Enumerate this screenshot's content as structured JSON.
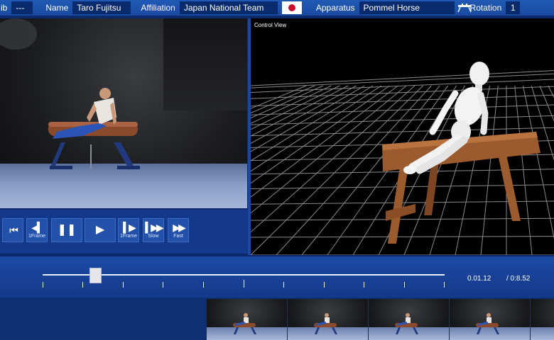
{
  "header": {
    "club_label": "ib",
    "club_value": "---",
    "name_label": "Name",
    "name_value": "Taro Fujitsu",
    "affiliation_label": "Affiliation",
    "affiliation_value": "Japan National Team",
    "apparatus_label": "Apparatus",
    "apparatus_value": "Pommel Horse",
    "rotation_label": "Rotation",
    "rotation_value": "1"
  },
  "controls": {
    "frame_back_caption": "1Frame",
    "frame_fwd_caption": "1Frame",
    "slow_caption": "Slow",
    "fast_caption": "Fast"
  },
  "control_view": {
    "title": "Control View"
  },
  "timeline": {
    "current_time": "0.01.12",
    "total_time": "/ 0:8.52",
    "progress": 0.13
  },
  "colors": {
    "header_bg": "#1a4aa0",
    "field_bg": "#0a2a6e",
    "panel_bg": "#14398a",
    "flag_red": "#c8102e",
    "button_bg": "#2350a8"
  }
}
